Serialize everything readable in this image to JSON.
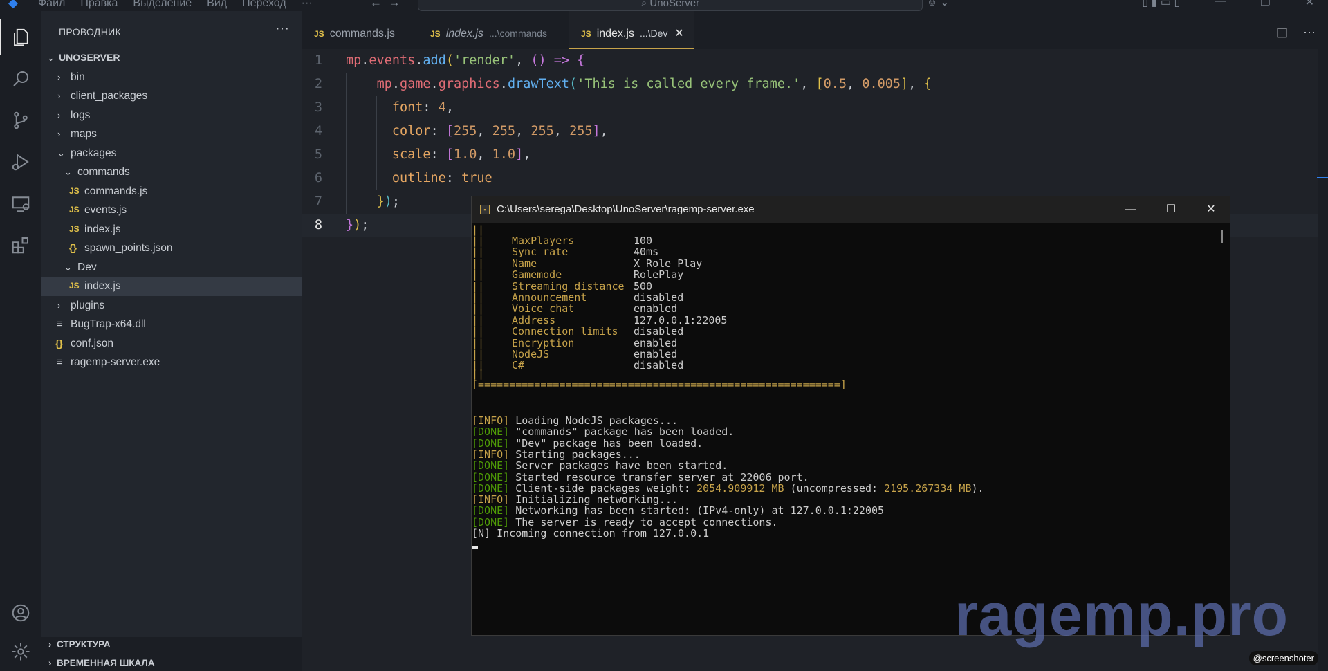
{
  "titlebar": {
    "menu": [
      "Файл",
      "Правка",
      "Выделение",
      "Вид",
      "Переход",
      "···"
    ],
    "search": "⌕ UnoServer"
  },
  "explorer": {
    "header": "ПРОВОДНИК",
    "root": "UNOSERVER",
    "items": [
      {
        "label": "bin"
      },
      {
        "label": "client_packages"
      },
      {
        "label": "logs"
      },
      {
        "label": "maps"
      },
      {
        "label": "packages"
      },
      {
        "label": "commands"
      },
      {
        "label": "commands.js"
      },
      {
        "label": "events.js"
      },
      {
        "label": "index.js"
      },
      {
        "label": "spawn_points.json"
      },
      {
        "label": "Dev"
      },
      {
        "label": "index.js"
      },
      {
        "label": "plugins"
      },
      {
        "label": "BugTrap-x64.dll"
      },
      {
        "label": "conf.json"
      },
      {
        "label": "ragemp-server.exe"
      }
    ],
    "outline": "СТРУКТУРА",
    "timeline": "ВРЕМЕННАЯ ШКАЛА"
  },
  "tabs": [
    {
      "label": "commands.js",
      "desc": ""
    },
    {
      "label": "index.js",
      "desc": "...\\commands"
    },
    {
      "label": "index.js",
      "desc": "...\\Dev"
    }
  ],
  "editor": {
    "line_numbers": [
      "1",
      "2",
      "3",
      "4",
      "5",
      "6",
      "7",
      "8"
    ]
  },
  "console": {
    "title": "C:\\Users\\serega\\Desktop\\UnoServer\\ragemp-server.exe",
    "config": [
      {
        "key": "MaxPlayers",
        "value": "100"
      },
      {
        "key": "Sync rate",
        "value": "40ms"
      },
      {
        "key": "Name",
        "value": "X Role Play"
      },
      {
        "key": "Gamemode",
        "value": "RolePlay"
      },
      {
        "key": "Streaming distance",
        "value": "500"
      },
      {
        "key": "Announcement",
        "value": "disabled"
      },
      {
        "key": "Voice chat",
        "value": "enabled"
      },
      {
        "key": "Address",
        "value": "127.0.0.1:22005"
      },
      {
        "key": "Connection limits",
        "value": "disabled"
      },
      {
        "key": "Encryption",
        "value": "enabled"
      },
      {
        "key": "NodeJS",
        "value": "enabled"
      },
      {
        "key": "C#",
        "value": "disabled"
      }
    ],
    "border_bottom": "[==========================================================]",
    "log": [
      {
        "tag": "[INFO]",
        "text": " Loading NodeJS packages..."
      },
      {
        "tag": "[DONE]",
        "text": " \"commands\" package has been loaded."
      },
      {
        "tag": "[DONE]",
        "text": " \"Dev\" package has been loaded."
      },
      {
        "tag": "[INFO]",
        "text": " Starting packages..."
      },
      {
        "tag": "[DONE]",
        "text": " Server packages have been started."
      },
      {
        "tag": "[DONE]",
        "text": " Started resource transfer server at 22006 port."
      },
      {
        "tag": "[DONE]",
        "text": " Client-side packages weight: "
      },
      {
        "tag": "[INFO]",
        "text": " Initializing networking..."
      },
      {
        "tag": "[DONE]",
        "text": " Networking has been started: (IPv4-only) at 127.0.0.1:22005"
      },
      {
        "tag": "[DONE]",
        "text": " The server is ready to accept connections."
      }
    ],
    "weight_a": "2054.909912 MB",
    "weight_mid": " (uncompressed: ",
    "weight_b": "2195.267334 MB",
    "weight_end": ").",
    "last_line": "[N] Incoming connection from 127.0.0.1"
  },
  "watermark": "ragemp.pro",
  "badge": "@screenshoter",
  "colors": {
    "accent": "#c7a34a",
    "done": "#4e9a06",
    "info": "#c7a34a"
  }
}
